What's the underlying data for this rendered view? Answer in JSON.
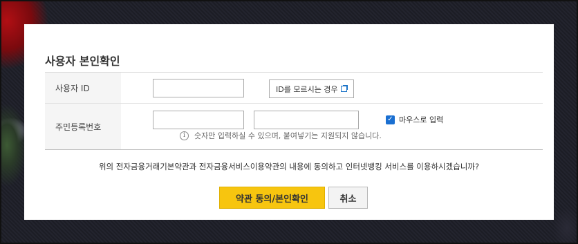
{
  "dialog": {
    "title": "사용자 본인확인",
    "user_id": {
      "label": "사용자 ID",
      "value": "",
      "find_button_label": "ID를 모르시는 경우"
    },
    "resident_number": {
      "label": "주민등록번호",
      "front_value": "",
      "separator": "-",
      "back_value": "",
      "mouse_input_label": "마우스로 입력",
      "mouse_input_checked": true,
      "hint": "숫자만 입력하실 수 있으며, 붙여넣기는 지원되지 않습니다."
    },
    "agreement_text": "위의 전자금융거래기본약관과 전자금융서비스이용약관의 내용에 동의하고 인터넷뱅킹 서비스를 이용하시겠습니까?",
    "confirm_button_label": "약관 동의/본인확인",
    "cancel_button_label": "취소"
  },
  "icons": {
    "external_link": "external-link-icon",
    "checkbox": "checkmark-icon",
    "info": "info-icon"
  },
  "colors": {
    "accent_button": "#f7c50f",
    "checkbox": "#1a6fd1"
  }
}
